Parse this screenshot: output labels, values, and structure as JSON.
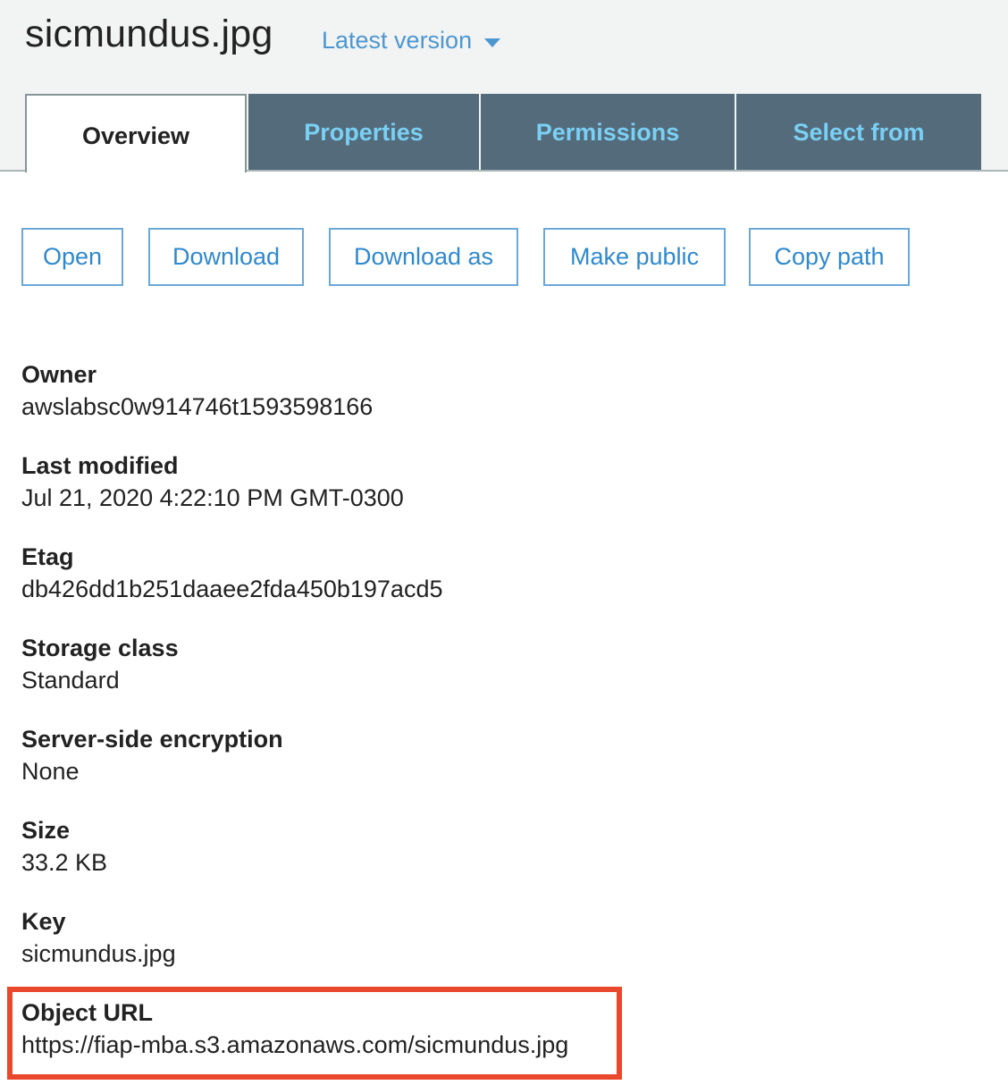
{
  "object": {
    "filename": "sicmundus.jpg",
    "version_label": "Latest version"
  },
  "tabs": [
    {
      "label": "Overview",
      "active": true
    },
    {
      "label": "Properties",
      "active": false
    },
    {
      "label": "Permissions",
      "active": false
    },
    {
      "label": "Select from",
      "active": false
    }
  ],
  "actions": {
    "open": "Open",
    "download": "Download",
    "download_as": "Download as",
    "make_public": "Make public",
    "copy_path": "Copy path"
  },
  "properties": {
    "owner": {
      "label": "Owner",
      "value": "awslabsc0w914746t1593598166"
    },
    "last_modified": {
      "label": "Last modified",
      "value": "Jul 21, 2020 4:22:10 PM GMT-0300"
    },
    "etag": {
      "label": "Etag",
      "value": "db426dd1b251daaee2fda450b197acd5"
    },
    "storage_class": {
      "label": "Storage class",
      "value": "Standard"
    },
    "encryption": {
      "label": "Server-side encryption",
      "value": "None"
    },
    "size": {
      "label": "Size",
      "value": "33.2 KB"
    },
    "key": {
      "label": "Key",
      "value": "sicmundus.jpg"
    },
    "object_url": {
      "label": "Object URL",
      "value": "https://fiap-mba.s3.amazonaws.com/sicmundus.jpg"
    }
  },
  "colors": {
    "accent": "#2f89ce",
    "tab_bg": "#546b7b",
    "tab_text": "#7ad0f4",
    "highlight": "#e8492d"
  },
  "icons": {
    "version_dropdown": "caret-down-icon"
  }
}
